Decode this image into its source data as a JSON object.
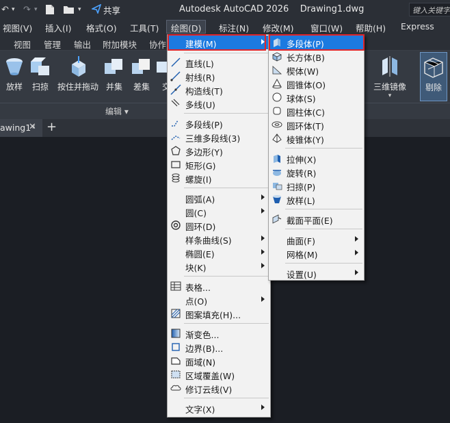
{
  "title_bar": {
    "share_label": "共享",
    "app_title": "Autodesk AutoCAD 2026    Drawing1.dwg",
    "search_placeholder": "键入关键字"
  },
  "menu_bar": [
    {
      "label": "视图(V)"
    },
    {
      "label": "插入(I)"
    },
    {
      "label": "格式(O)"
    },
    {
      "label": "工具(T)"
    },
    {
      "label": "绘图(D)"
    },
    {
      "label": "标注(N)"
    },
    {
      "label": "修改(M)"
    },
    {
      "label": "窗口(W)"
    },
    {
      "label": "帮助(H)"
    },
    {
      "label": "Express"
    }
  ],
  "ribbon_tabs": [
    {
      "label": "视图"
    },
    {
      "label": "管理"
    },
    {
      "label": "输出"
    },
    {
      "label": "附加模块"
    },
    {
      "label": "协作"
    }
  ],
  "ribbon": {
    "buttons": [
      {
        "label": "放样"
      },
      {
        "label": "扫掠"
      },
      {
        "label": "按住并拖动"
      },
      {
        "label": "并集"
      },
      {
        "label": "差集"
      },
      {
        "label": "交"
      },
      {
        "label": "三维镜像"
      },
      {
        "label": "剔除"
      }
    ],
    "panel_title": "编辑 ▾"
  },
  "doc_tab": {
    "label": "awing1*",
    "close": "✕",
    "add": "+"
  },
  "draw_menu": {
    "items": [
      {
        "label": "建模(M)",
        "key": "M"
      },
      {
        "label": "直线(L)"
      },
      {
        "label": "射线(R)"
      },
      {
        "label": "构造线(T)"
      },
      {
        "label": "多线(U)"
      },
      {
        "label": "多段线(P)"
      },
      {
        "label": "三维多段线(3)"
      },
      {
        "label": "多边形(Y)"
      },
      {
        "label": "矩形(G)"
      },
      {
        "label": "螺旋(I)"
      },
      {
        "label": "圆弧(A)"
      },
      {
        "label": "圆(C)"
      },
      {
        "label": "圆环(D)"
      },
      {
        "label": "样条曲线(S)"
      },
      {
        "label": "椭圆(E)"
      },
      {
        "label": "块(K)"
      },
      {
        "label": "表格..."
      },
      {
        "label": "点(O)"
      },
      {
        "label": "图案填充(H)..."
      },
      {
        "label": "渐变色..."
      },
      {
        "label": "边界(B)..."
      },
      {
        "label": "面域(N)"
      },
      {
        "label": "区域覆盖(W)"
      },
      {
        "label": "修订云线(V)"
      },
      {
        "label": "文字(X)"
      }
    ]
  },
  "modeling_menu": {
    "items": [
      {
        "label": "多段体(P)"
      },
      {
        "label": "长方体(B)"
      },
      {
        "label": "楔体(W)"
      },
      {
        "label": "圆锥体(O)"
      },
      {
        "label": "球体(S)"
      },
      {
        "label": "圆柱体(C)"
      },
      {
        "label": "圆环体(T)"
      },
      {
        "label": "棱锥体(Y)"
      },
      {
        "label": "拉伸(X)"
      },
      {
        "label": "旋转(R)"
      },
      {
        "label": "扫掠(P)"
      },
      {
        "label": "放样(L)"
      },
      {
        "label": "截面平面(E)"
      },
      {
        "label": "曲面(F)"
      },
      {
        "label": "网格(M)"
      },
      {
        "label": "设置(U)"
      }
    ]
  },
  "colors": {
    "highlight": "#1c7ae0",
    "callout_red": "#e0252a",
    "menu_bg": "#f2f2f2",
    "dark_bg": "#1b1e24"
  }
}
